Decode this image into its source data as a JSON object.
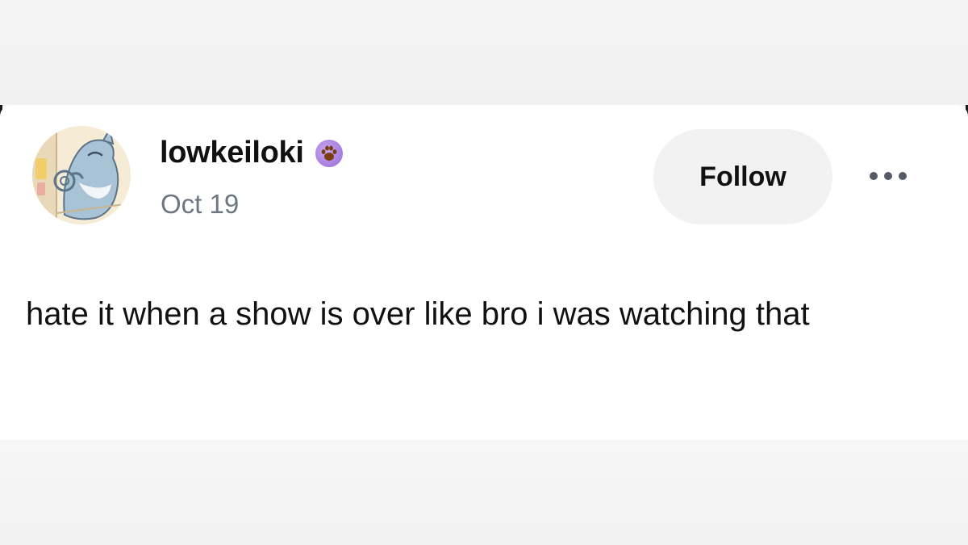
{
  "post": {
    "username": "lowkeiloki",
    "badge_icon": "paw-badge-icon",
    "date": "Oct 19",
    "follow_label": "Follow",
    "more_icon": "more-options-icon",
    "body": "hate it when a show is over like bro i was watching that"
  },
  "colors": {
    "username": "#111111",
    "date": "#6f7683",
    "follow_bg": "#f2f2f2",
    "badge": "#a47de0",
    "paw": "#7a3d12"
  }
}
